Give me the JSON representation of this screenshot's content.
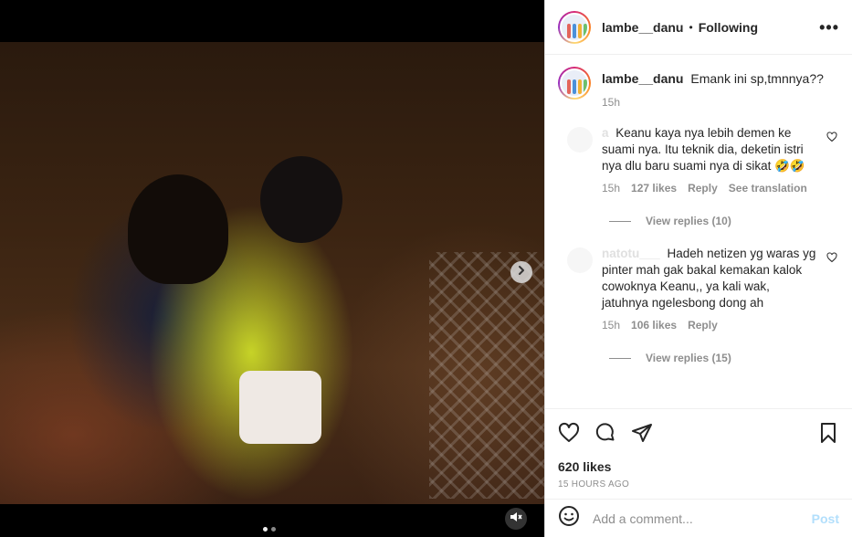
{
  "header": {
    "handle": "lambe__danu",
    "separator": "•",
    "follow_status": "Following",
    "more": "•••"
  },
  "caption": {
    "handle": "lambe__danu",
    "text": "Emank ini sp,tmnnya??",
    "time": "15h"
  },
  "comments": [
    {
      "user": "a",
      "text": "Keanu kaya nya lebih demen ke suami nya. Itu teknik dia, deketin istri nya dlu baru suami nya di sikat 🤣🤣",
      "time": "15h",
      "likes": "127 likes",
      "reply": "Reply",
      "translate": "See translation",
      "view_replies": "View replies (10)"
    },
    {
      "user": "natotu___",
      "text": "Hadeh netizen yg waras yg pinter mah gak bakal kemakan kalok cowoknya Keanu,, ya kali wak, jatuhnya ngelesbong dong ah",
      "time": "15h",
      "likes": "106 likes",
      "reply": "Reply",
      "view_replies": "View replies (15)"
    }
  ],
  "actions": {
    "likes": "620 likes",
    "posted_ago": "15 HOURS AGO"
  },
  "add_comment": {
    "placeholder": "Add a comment...",
    "post_label": "Post"
  },
  "carousel": {
    "current": 1,
    "total": 2
  },
  "colors": {
    "accent_post": "#b2dffc",
    "muted": "#8e8e8e",
    "text": "#262626"
  },
  "icons": [
    "chevron-right-icon",
    "mute-icon",
    "heart-icon",
    "comment-icon",
    "share-icon",
    "bookmark-icon",
    "emoji-icon",
    "more-icon"
  ]
}
